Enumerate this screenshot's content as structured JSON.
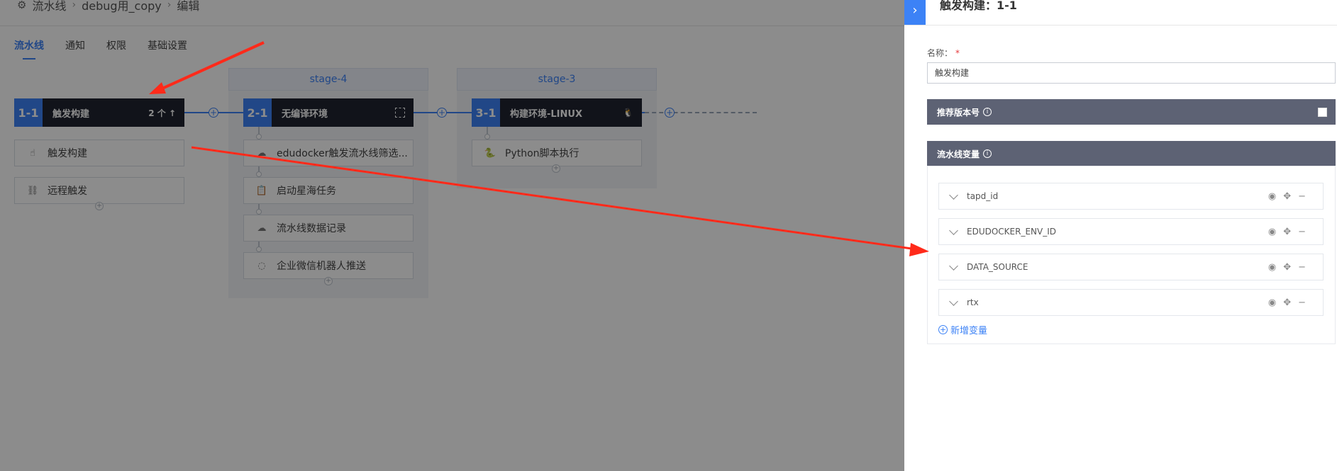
{
  "breadcrumb": {
    "items": [
      "流水线",
      "debug用_copy",
      "编辑"
    ]
  },
  "tabs": [
    "流水线",
    "通知",
    "权限",
    "基础设置"
  ],
  "stages": [
    {
      "label": "",
      "job": {
        "num": "1-1",
        "name": "触发构建",
        "tail": "2 个"
      },
      "plugins": [
        {
          "icon": "hand-pointer-icon",
          "name": "触发构建"
        },
        {
          "icon": "remote-trigger-icon",
          "name": "远程触发"
        }
      ]
    },
    {
      "label": "stage-4",
      "job": {
        "num": "2-1",
        "name": "无编译环境",
        "tail": ""
      },
      "plugins": [
        {
          "icon": "cloud-icon",
          "name": "edudocker触发流水线筛选..."
        },
        {
          "icon": "clipboard-icon",
          "name": "启动星海任务"
        },
        {
          "icon": "cloud-icon",
          "name": "流水线数据记录"
        },
        {
          "icon": "wechat-bot-icon",
          "name": "企业微信机器人推送"
        }
      ]
    },
    {
      "label": "stage-3",
      "job": {
        "num": "3-1",
        "name": "构建环境-LINUX",
        "tail": ""
      },
      "plugins": [
        {
          "icon": "python-icon",
          "name": "Python脚本执行"
        }
      ]
    }
  ],
  "panel": {
    "title": "触发构建：1-1",
    "name_label": "名称：",
    "required_mark": "*",
    "name_value": "触发构建",
    "recommend_version_label": "推荐版本号",
    "pipeline_vars_label": "流水线变量",
    "variables": [
      "tapd_id",
      "EDUDOCKER_ENV_ID",
      "DATA_SOURCE",
      "rtx"
    ],
    "add_variable_label": "新增变量"
  },
  "colors": {
    "accent": "#3c82f6",
    "annotation_arrow": "#ff2a1a",
    "section_header": "#5d6274"
  }
}
